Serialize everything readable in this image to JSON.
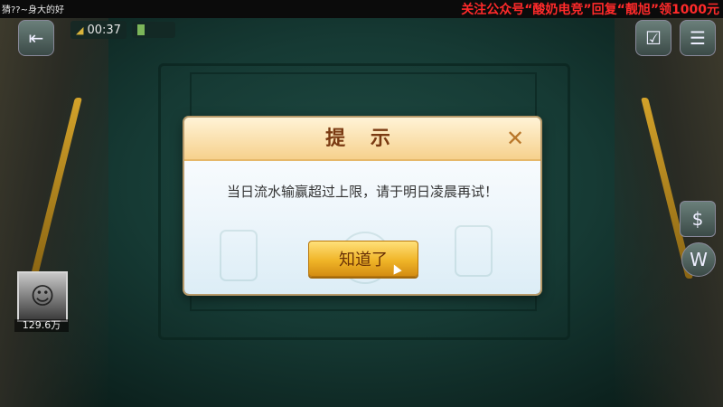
{
  "topbar": {
    "corner_text": "猜??~身大的好",
    "promo_text": "关注公众号“酸奶电竞”回复“靓旭”领1000元"
  },
  "hud": {
    "timer": "00:37",
    "avatar_score": "129.6万"
  },
  "dialog": {
    "title": "提 示",
    "message": "当日流水输赢超过上限，请于明日凌晨再试！",
    "ok_label": "知道了"
  },
  "icons": {
    "exit": "exit-icon",
    "check": "calendar-check-icon",
    "menu": "menu-list-icon",
    "money": "money-icon",
    "bulb": "lightbulb-icon",
    "close": "close-icon"
  }
}
